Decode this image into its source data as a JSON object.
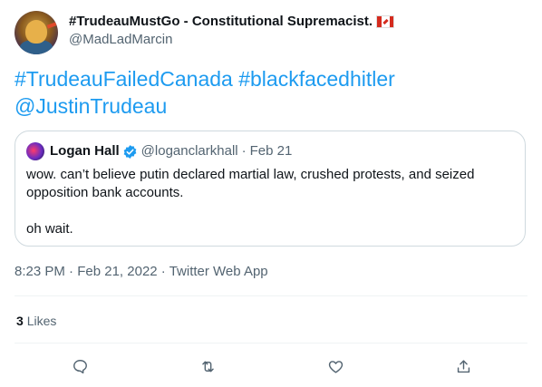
{
  "author": {
    "display_name": "#TrudeauMustGo - Constitutional Supremacist.",
    "handle": "@MadLadMarcin",
    "flag_icon": "canada-flag-icon"
  },
  "tweet": {
    "hashtag_1": "#TrudeauFailedCanada",
    "hashtag_2": "#blackfacedhitler",
    "mention": "@JustinTrudeau"
  },
  "quote": {
    "name": "Logan Hall",
    "handle": "@loganclarkhall",
    "dot": "·",
    "date": "Feb 21",
    "line_1": "wow. can’t believe putin declared martial law, crushed protests, and seized opposition bank accounts.",
    "line_2": "oh wait."
  },
  "meta": {
    "time": "8:23 PM",
    "sep": "·",
    "date": "Feb 21, 2022",
    "source": "Twitter Web App"
  },
  "stats": {
    "likes_count": "3",
    "likes_label": "Likes"
  },
  "colors": {
    "link": "#1d9bf0",
    "muted": "#536471",
    "border": "#cfd9de"
  },
  "icons": [
    "reply-icon",
    "retweet-icon",
    "like-icon",
    "share-icon",
    "verified-badge-icon"
  ]
}
